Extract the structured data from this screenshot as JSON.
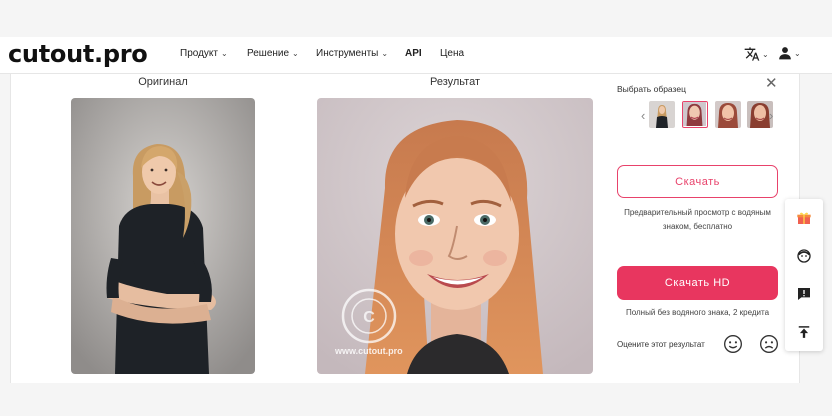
{
  "header": {
    "logo": "cutout.pro",
    "nav": [
      {
        "label": "Продукт",
        "dropdown": true
      },
      {
        "label": "Решение",
        "dropdown": true
      },
      {
        "label": "Инструменты",
        "dropdown": true
      },
      {
        "label": "API",
        "dropdown": false
      },
      {
        "label": "Цена",
        "dropdown": false
      }
    ],
    "icons": [
      "translate-icon",
      "user-icon"
    ]
  },
  "main": {
    "original_title": "Оригинал",
    "result_title": "Результат",
    "watermark_text": "www.cutout.pro"
  },
  "side": {
    "sample_label": "Выбрать образец",
    "thumbnails": [
      {
        "active": false
      },
      {
        "active": true
      },
      {
        "active": false
      },
      {
        "active": false
      }
    ],
    "download_label": "Скачать",
    "download_note": "Предварительный просмотр с водяным знаком, бесплатно",
    "download_hd_label": "Скачать HD",
    "download_hd_note": "Полный без водяного знака, 2 кредита",
    "rate_label": "Оцените этот результат"
  },
  "colors": {
    "accent": "#e8365f",
    "accent_outline": "#e8426b"
  },
  "float_icons": [
    "gift-icon",
    "support-icon",
    "feedback-icon",
    "back-to-top-icon"
  ]
}
